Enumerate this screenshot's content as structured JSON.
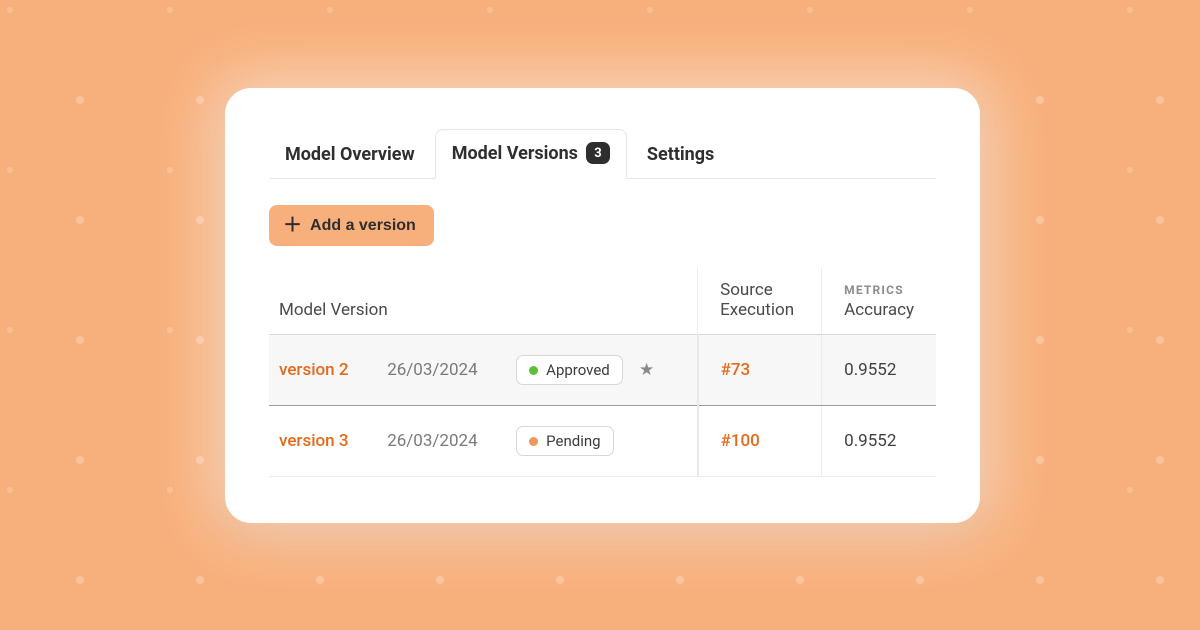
{
  "tabs": {
    "overview": "Model Overview",
    "versions": "Model Versions",
    "versions_count": "3",
    "settings": "Settings"
  },
  "toolbar": {
    "add_version": "Add a version"
  },
  "table": {
    "headers": {
      "model_version": "Model Version",
      "source_execution": "Source Execution",
      "metrics_label": "METRICS",
      "accuracy": "Accuracy"
    },
    "rows": [
      {
        "version": "version 2",
        "date": "26/03/2024",
        "status": "Approved",
        "status_kind": "approved",
        "starred": true,
        "source": "#73",
        "accuracy": "0.9552"
      },
      {
        "version": "version 3",
        "date": "26/03/2024",
        "status": "Pending",
        "status_kind": "pending",
        "starred": false,
        "source": "#100",
        "accuracy": "0.9552"
      }
    ]
  },
  "colors": {
    "accent": "#e56a1c",
    "bg": "#f7b07c",
    "approved_dot": "#5bbf3a",
    "pending_dot": "#f0985a"
  }
}
